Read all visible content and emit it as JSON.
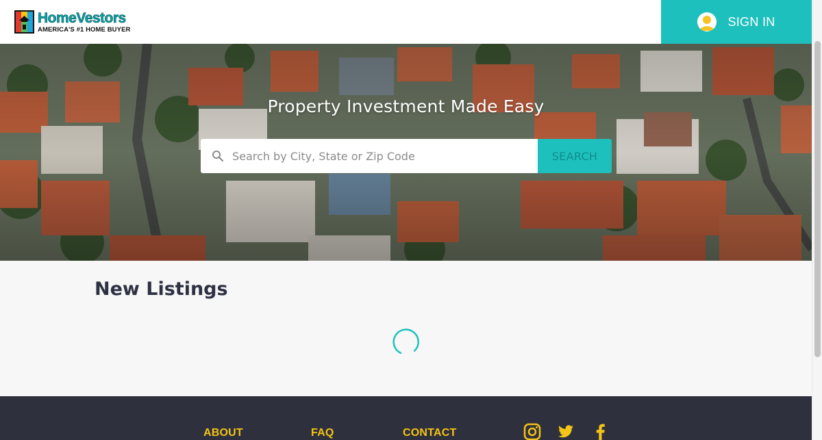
{
  "header": {
    "logo_name": "HomeVestors",
    "logo_tagline": "AMERICA'S #1 HOME BUYER",
    "signin_label": "SIGN IN"
  },
  "hero": {
    "title": "Property Investment Made Easy",
    "search": {
      "placeholder": "Search by City, State or Zip Code",
      "value": "",
      "button_label": "SEARCH"
    }
  },
  "listings": {
    "title": "New Listings",
    "loading": true
  },
  "footer": {
    "links": [
      "ABOUT",
      "FAQ",
      "CONTACT"
    ],
    "social_icons": [
      "instagram-icon",
      "twitter-icon",
      "facebook-icon"
    ]
  },
  "colors": {
    "accent": "#1ec0bd",
    "footer_bg": "#2f303d",
    "footer_link": "#f4c416",
    "heading": "#2d3142"
  }
}
